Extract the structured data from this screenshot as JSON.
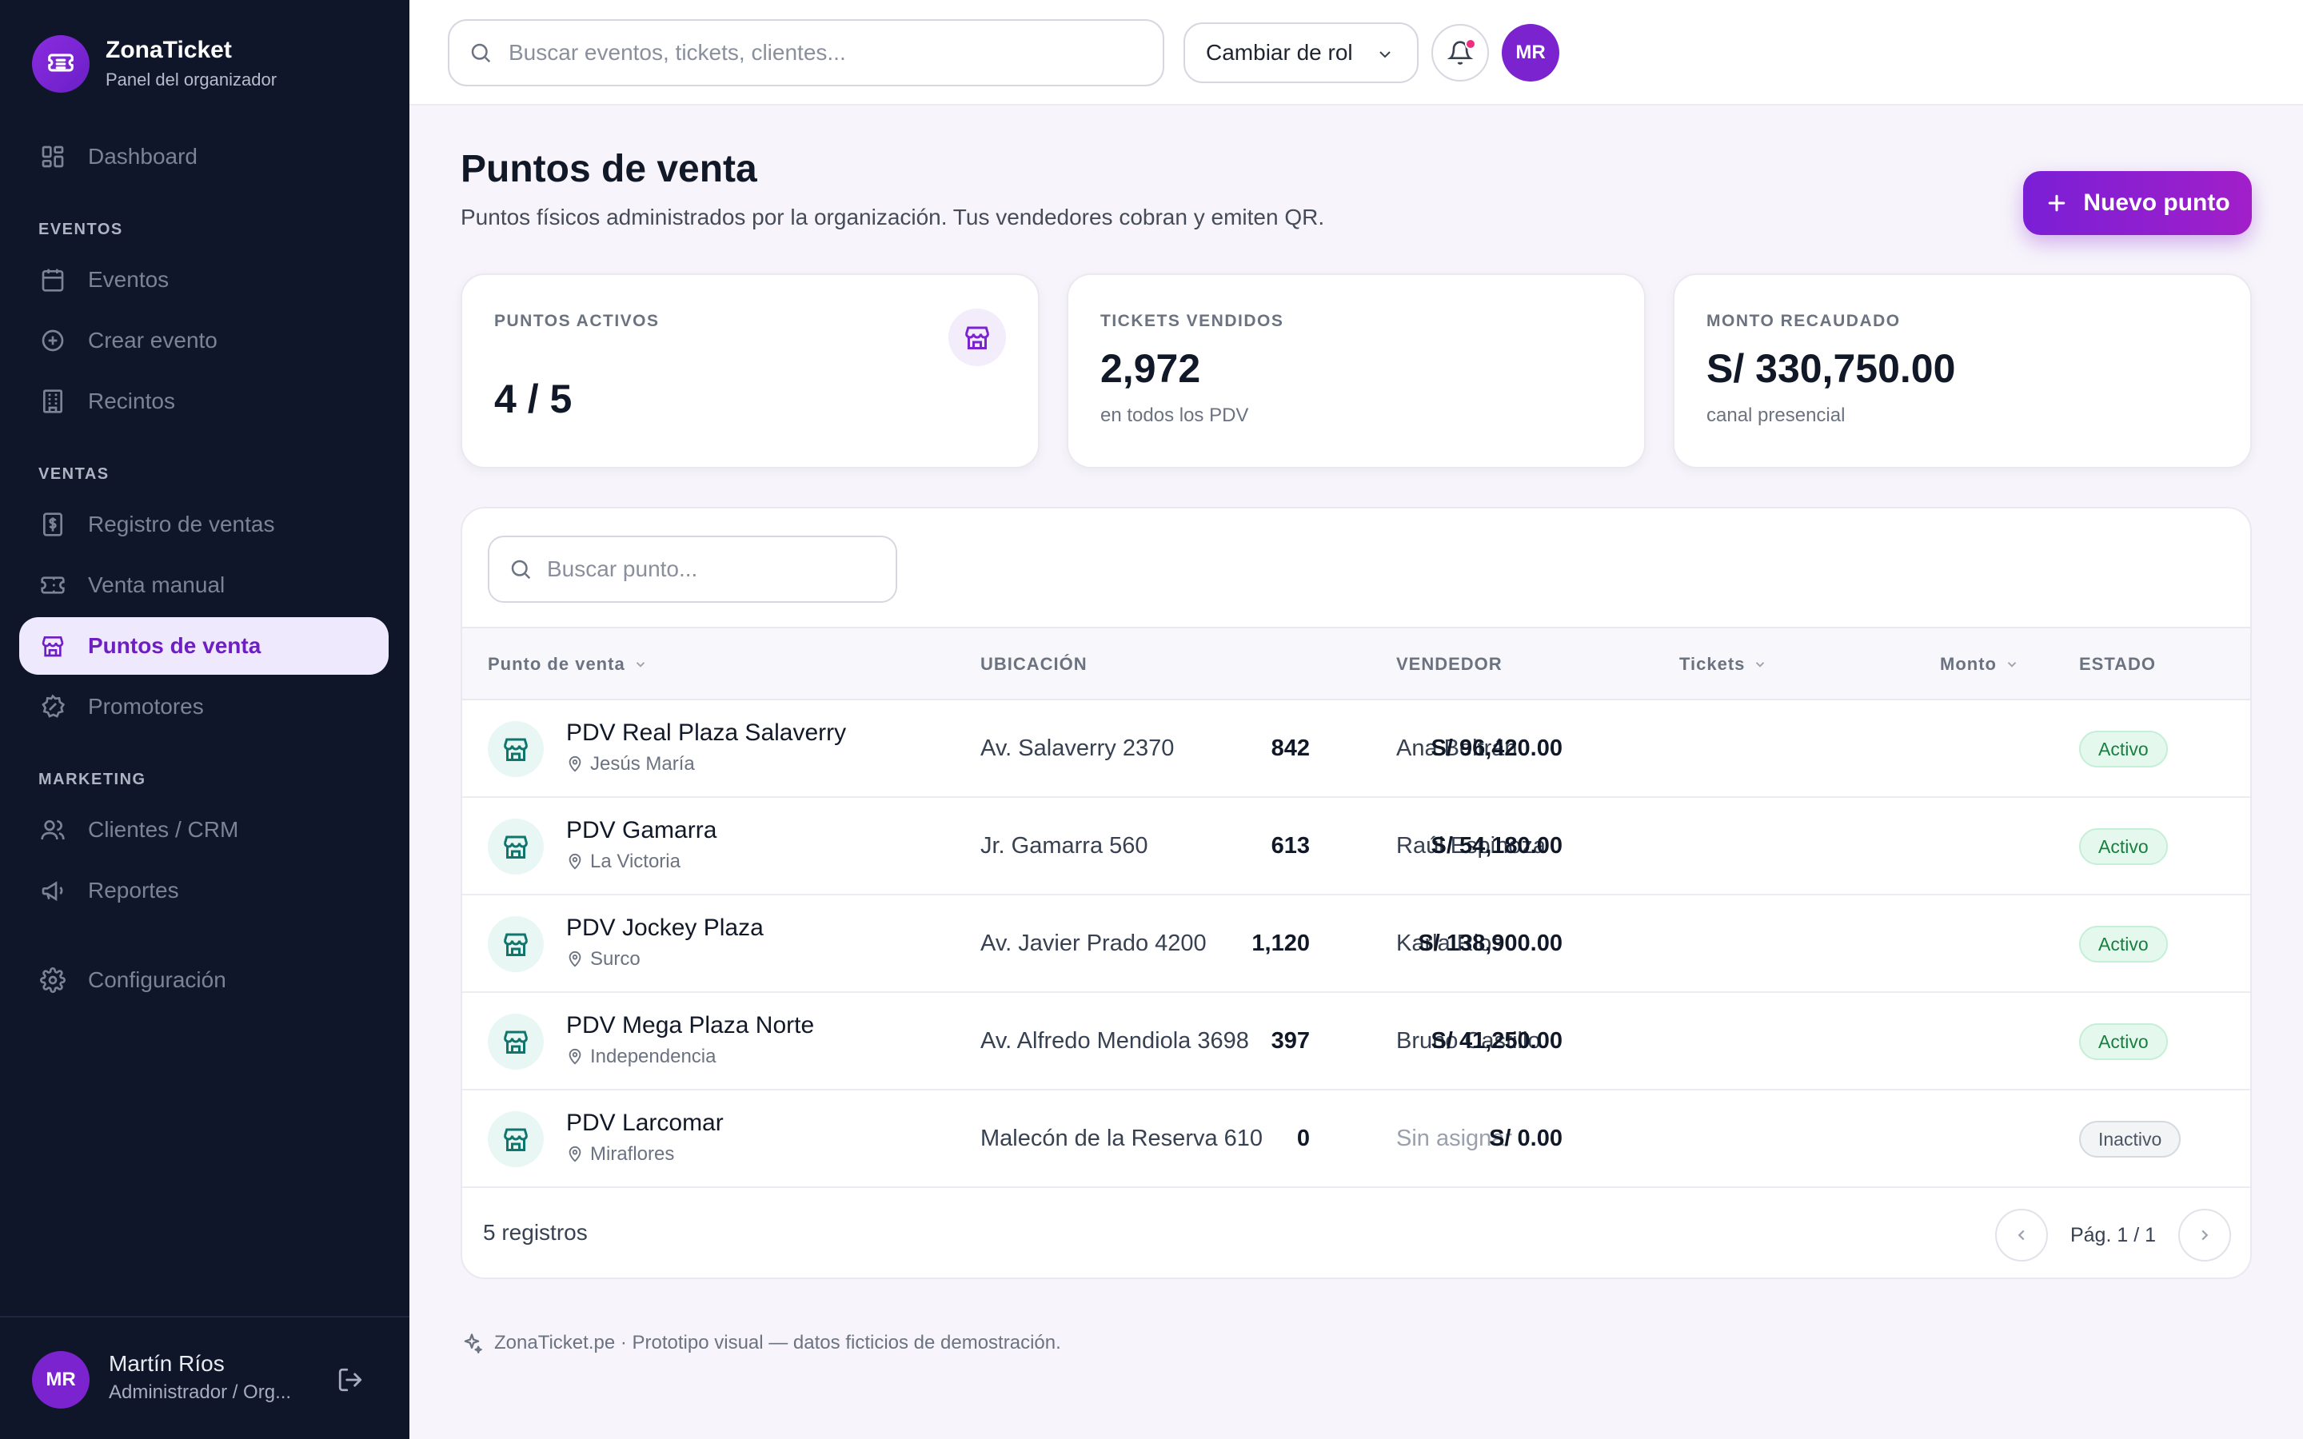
{
  "brand": {
    "name": "ZonaTicket",
    "subtitle": "Panel del organizador"
  },
  "nav": {
    "dashboard": "Dashboard",
    "section_eventos": "EVENTOS",
    "eventos": "Eventos",
    "crear_evento": "Crear evento",
    "recintos": "Recintos",
    "section_ventas": "VENTAS",
    "registro_ventas": "Registro de ventas",
    "venta_manual": "Venta manual",
    "puntos_venta": "Puntos de venta",
    "promotores": "Promotores",
    "section_marketing": "MARKETING",
    "clientes": "Clientes / CRM",
    "reportes": "Reportes",
    "configuracion": "Configuración"
  },
  "user": {
    "initials": "MR",
    "name": "Martín Ríos",
    "role": "Administrador / Org..."
  },
  "topbar": {
    "search_placeholder": "Buscar eventos, tickets, clientes...",
    "role_button": "Cambiar de rol",
    "avatar_initials": "MR"
  },
  "header": {
    "title": "Puntos de venta",
    "description": "Puntos físicos administrados por la organización. Tus vendedores cobran y emiten QR.",
    "new_button": "Nuevo punto"
  },
  "stats": [
    {
      "label": "PUNTOS ACTIVOS",
      "value": "4 / 5",
      "sub": ""
    },
    {
      "label": "TICKETS VENDIDOS",
      "value": "2,972",
      "sub": "en todos los PDV"
    },
    {
      "label": "MONTO RECAUDADO",
      "value": "S/ 330,750.00",
      "sub": "canal presencial"
    }
  ],
  "table": {
    "search_placeholder": "Buscar punto...",
    "columns": {
      "punto": "Punto de venta",
      "ubicacion": "UBICACIÓN",
      "vendedor": "VENDEDOR",
      "tickets": "Tickets",
      "monto": "Monto",
      "estado": "ESTADO"
    },
    "rows": [
      {
        "name": "PDV Real Plaza Salaverry",
        "district": "Jesús María",
        "location": "Av. Salaverry 2370",
        "seller": "Ana Beltrán",
        "tickets": "842",
        "amount": "S/ 96,420.00",
        "status": "Activo"
      },
      {
        "name": "PDV Gamarra",
        "district": "La Victoria",
        "location": "Jr. Gamarra 560",
        "seller": "Raúl Espinoza",
        "tickets": "613",
        "amount": "S/ 54,180.00",
        "status": "Activo"
      },
      {
        "name": "PDV Jockey Plaza",
        "district": "Surco",
        "location": "Av. Javier Prado 4200",
        "seller": "Karla Rios",
        "tickets": "1,120",
        "amount": "S/ 138,900.00",
        "status": "Activo"
      },
      {
        "name": "PDV Mega Plaza Norte",
        "district": "Independencia",
        "location": "Av. Alfredo Mendiola 3698",
        "seller": "Bruno Castillo",
        "tickets": "397",
        "amount": "S/ 41,250.00",
        "status": "Activo"
      },
      {
        "name": "PDV Larcomar",
        "district": "Miraflores",
        "location": "Malecón de la Reserva 610",
        "seller": "Sin asignar",
        "tickets": "0",
        "amount": "S/ 0.00",
        "status": "Inactivo"
      }
    ],
    "count": "5 registros",
    "page": "Pág. 1 / 1"
  },
  "footnote": "ZonaTicket.pe · Prototipo visual — datos ficticios de demostración.",
  "colors": {
    "accent": "#7a23cf",
    "sidebar": "#0f1629",
    "active_badge": "#17803f",
    "teal_icon": "#0f766e"
  }
}
